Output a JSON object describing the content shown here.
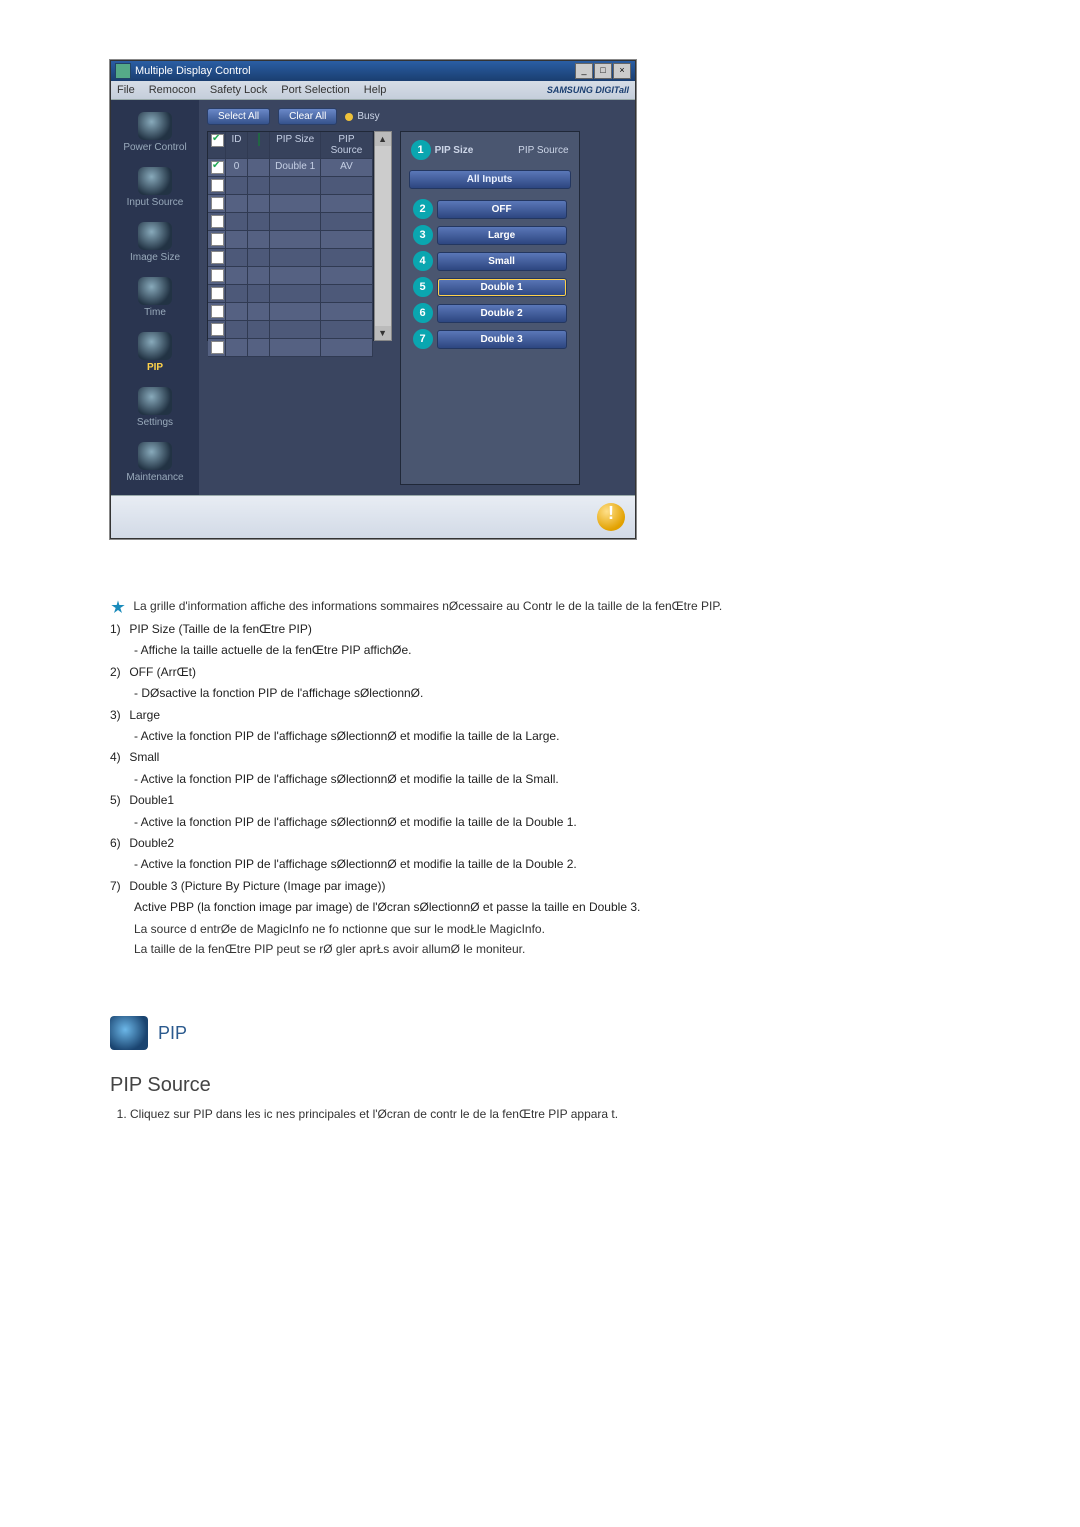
{
  "app": {
    "title": "Multiple Display Control",
    "menubar": [
      "File",
      "Remocon",
      "Safety Lock",
      "Port Selection",
      "Help"
    ],
    "brand": "SAMSUNG DIGITall"
  },
  "sidebar": {
    "items": [
      {
        "label": "Power Control"
      },
      {
        "label": "Input Source"
      },
      {
        "label": "Image Size"
      },
      {
        "label": "Time"
      },
      {
        "label": "PIP",
        "selected": true
      },
      {
        "label": "Settings"
      },
      {
        "label": "Maintenance"
      }
    ]
  },
  "toolbar": {
    "select_all": "Select All",
    "clear_all": "Clear All",
    "busy": "Busy"
  },
  "grid": {
    "headers": {
      "c1": "",
      "c2": "ID",
      "c3": "",
      "c4": "PIP Size",
      "c5": "PIP Source"
    },
    "rows": [
      {
        "checked": true,
        "id": "0",
        "status": "on",
        "pip_size": "Double 1",
        "pip_source": "AV"
      },
      {
        "checked": false
      },
      {
        "checked": false
      },
      {
        "checked": false
      },
      {
        "checked": false
      },
      {
        "checked": false
      },
      {
        "checked": false
      },
      {
        "checked": false
      },
      {
        "checked": false
      },
      {
        "checked": false
      },
      {
        "checked": false
      }
    ]
  },
  "options": {
    "head_left": "PIP Size",
    "head_right": "PIP Source",
    "all_inputs": "All Inputs",
    "buttons": [
      {
        "n": "2",
        "label": "OFF"
      },
      {
        "n": "3",
        "label": "Large"
      },
      {
        "n": "4",
        "label": "Small"
      },
      {
        "n": "5",
        "label": "Double 1",
        "selected": true
      },
      {
        "n": "6",
        "label": "Double 2"
      },
      {
        "n": "7",
        "label": "Double 3"
      }
    ],
    "head_callout": "1"
  },
  "doc": {
    "lead": "La grille d'information affiche des informations sommaires nØcessaire au Contr le de la taille de la fenŒtre PIP.",
    "items": [
      {
        "n": "1)",
        "title": "PIP Size (Taille de la fenŒtre PIP)",
        "desc": "- Affiche la taille actuelle de la fenŒtre PIP affichØe."
      },
      {
        "n": "2)",
        "title": "OFF (ArrŒt)",
        "desc": "- DØsactive la fonction PIP de l'affichage sØlectionnØ."
      },
      {
        "n": "3)",
        "title": "Large",
        "desc": "- Active la fonction PIP de l'affichage sØlectionnØ et modifie la taille de la Large."
      },
      {
        "n": "4)",
        "title": "Small",
        "desc": "- Active la fonction PIP de l'affichage sØlectionnØ et modifie la taille de la Small."
      },
      {
        "n": "5)",
        "title": "Double1",
        "desc": "- Active la fonction PIP de l'affichage sØlectionnØ et modifie la taille de la Double 1."
      },
      {
        "n": "6)",
        "title": "Double2",
        "desc": "- Active la fonction PIP de l'affichage sØlectionnØ et modifie la taille de la Double 2."
      },
      {
        "n": "7)",
        "title": "Double 3 (Picture By Picture (Image par image))",
        "desc": "Active PBP (la fonction image par image) de l'Øcran sØlectionnØ et passe la taille en Double 3."
      }
    ],
    "notes": [
      "La source d entrØe de MagicInfo ne fo      nctionne que sur le modŁle MagicInfo.",
      "La taille de la fenŒtre PIP peut se rØ     gler aprŁs avoir allumØ le moniteur."
    ],
    "pip_label": "PIP",
    "section_title": "PIP Source",
    "section_body": "Cliquez sur PIP dans les ic nes principales et l'Øcran de contr le de la fenŒtre PIP appara t."
  }
}
